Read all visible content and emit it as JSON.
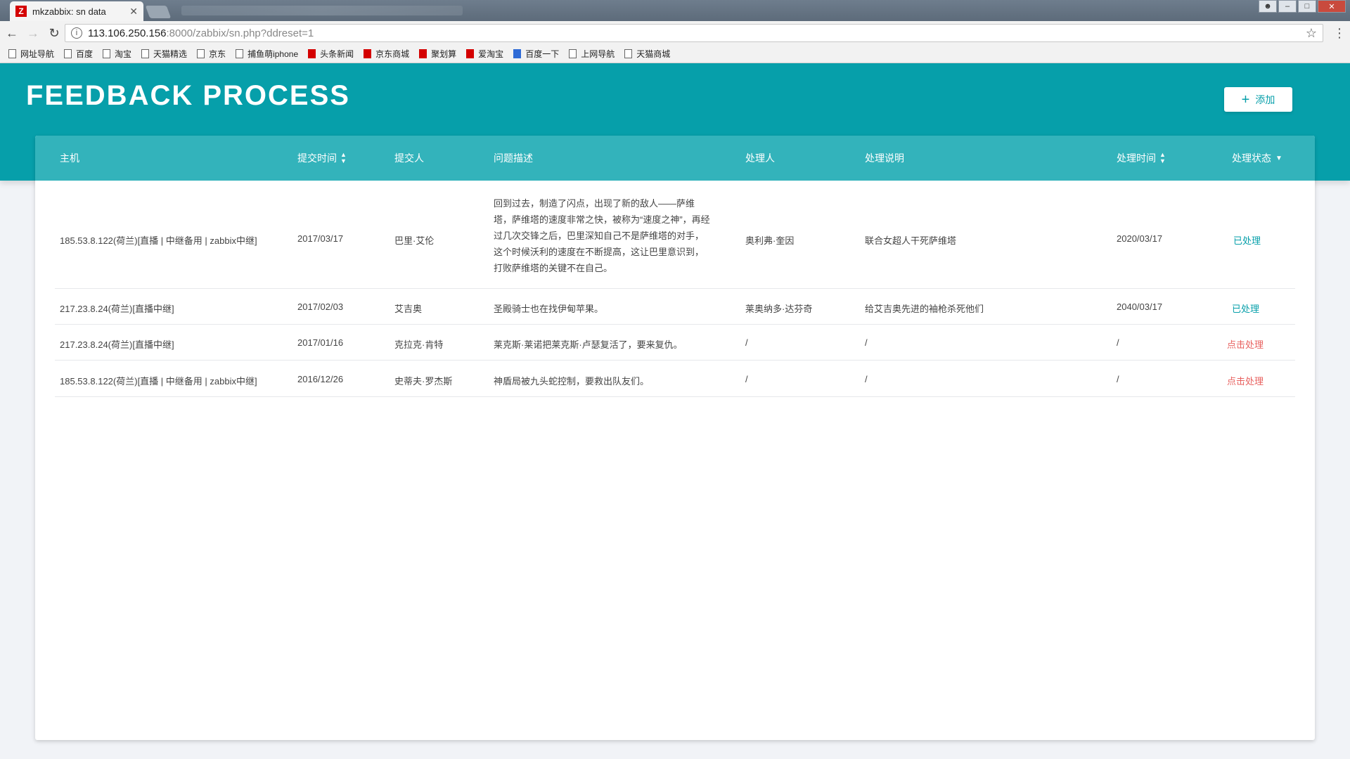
{
  "browser": {
    "tab_title": "mkzabbix: sn data",
    "tab_favicon": "Z",
    "url_host": "113.106.250.156",
    "url_path": ":8000/zabbix/sn.php?ddreset=1",
    "bookmarks": [
      "网址导航",
      "百度",
      "淘宝",
      "天猫精选",
      "京东",
      "捕鱼萌iphone",
      "头条新闻",
      "京东商城",
      "聚划算",
      "爱淘宝",
      "百度一下",
      "上网导航",
      "天猫商城"
    ]
  },
  "page": {
    "title": "FEEDBACK PROCESS",
    "add_button": "添加",
    "accent_color": "#069faa",
    "pending_color": "#e8615f"
  },
  "table": {
    "headers": {
      "host": "主机",
      "submit_time": "提交时间",
      "submitter": "提交人",
      "description": "问题描述",
      "handler": "处理人",
      "handling_note": "处理说明",
      "handle_time": "处理时间",
      "status": "处理状态"
    },
    "rows": [
      {
        "host": "185.53.8.122(荷兰)[直播 | 中继备用 | zabbix中继]",
        "submit_time": "2017/03/17",
        "submitter": "巴里·艾伦",
        "description": "回到过去，制造了闪点，出现了新的敌人——萨维塔，萨维塔的速度非常之快，被称为“速度之神”，再经过几次交锋之后，巴里深知自己不是萨维塔的对手，这个时候沃利的速度在不断提高，这让巴里意识到，打败萨维塔的关键不在自己。",
        "handler": "奥利弗·奎因",
        "handling_note": "联合女超人干死萨维塔",
        "handle_time": "2020/03/17",
        "status": "已处理"
      },
      {
        "host": "217.23.8.24(荷兰)[直播中继]",
        "submit_time": "2017/02/03",
        "submitter": "艾吉奥",
        "description": "圣殿骑士也在找伊甸苹果。",
        "handler": "莱奥纳多·达芬奇",
        "handling_note": "给艾吉奥先进的袖枪杀死他们",
        "handle_time": "2040/03/17",
        "status": "已处理"
      },
      {
        "host": "217.23.8.24(荷兰)[直播中继]",
        "submit_time": "2017/01/16",
        "submitter": "克拉克·肯特",
        "description": "莱克斯·莱诺把莱克斯·卢瑟复活了，要来复仇。",
        "handler": "/",
        "handling_note": "/",
        "handle_time": "/",
        "status": "点击处理"
      },
      {
        "host": "185.53.8.122(荷兰)[直播 | 中继备用 | zabbix中继]",
        "submit_time": "2016/12/26",
        "submitter": "史蒂夫·罗杰斯",
        "description": "神盾局被九头蛇控制，要救出队友们。",
        "handler": "/",
        "handling_note": "/",
        "handle_time": "/",
        "status": "点击处理"
      }
    ]
  }
}
